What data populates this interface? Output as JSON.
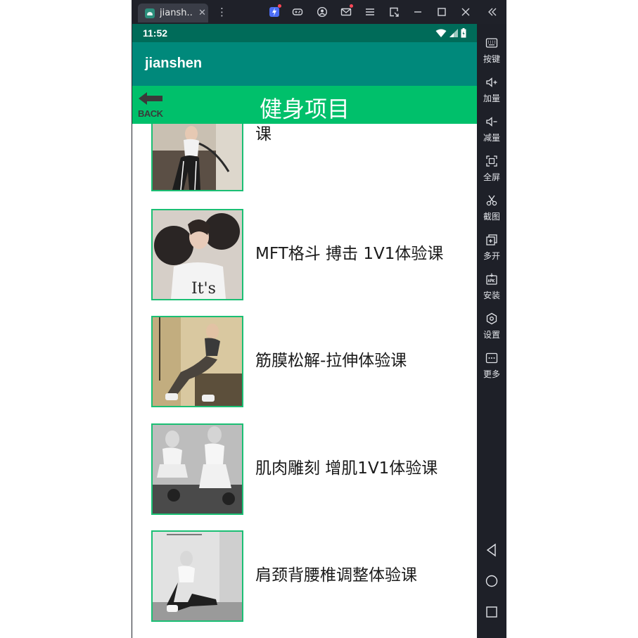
{
  "tabbar": {
    "tab_title": "jiansh...",
    "tab_close": "✕",
    "kebab": "⋮",
    "icons": [
      "bolt-icon",
      "gamepad-icon",
      "account-icon",
      "mail-icon",
      "menu-icon",
      "screen-rotate-icon",
      "minimize-icon",
      "maximize-icon",
      "close-icon",
      "collapse-icon"
    ]
  },
  "statusbar": {
    "time": "11:52"
  },
  "appbar": {
    "title": "jianshen"
  },
  "titlebar": {
    "back_label": "BACK",
    "title": "健身项目"
  },
  "list": {
    "items": [
      {
        "title": "蜜桃臀 马甲线 全身塑形体验课"
      },
      {
        "title": "MFT格斗 搏击 1V1体验课",
        "image_caption": "It's"
      },
      {
        "title": "筋膜松解-拉伸体验课"
      },
      {
        "title": "肌肉雕刻 增肌1V1体验课"
      },
      {
        "title": "肩颈背腰椎调整体验课"
      }
    ]
  },
  "sidebar": {
    "items": [
      {
        "label": "按键",
        "icon": "keyboard-icon"
      },
      {
        "label": "加量",
        "icon": "volume-up-icon"
      },
      {
        "label": "减量",
        "icon": "volume-down-icon"
      },
      {
        "label": "全屏",
        "icon": "fullscreen-icon"
      },
      {
        "label": "截图",
        "icon": "scissors-icon"
      },
      {
        "label": "多开",
        "icon": "multi-instance-icon"
      },
      {
        "label": "安装",
        "icon": "apk-install-icon"
      },
      {
        "label": "设置",
        "icon": "settings-icon"
      },
      {
        "label": "更多",
        "icon": "more-icon"
      }
    ],
    "nav": [
      "back-nav-icon",
      "home-nav-icon",
      "recents-nav-icon"
    ]
  },
  "colors": {
    "status_bar": "#006b59",
    "app_bar": "#00897b",
    "title_bar": "#00c06b",
    "thumb_border": "#1bbf74",
    "sidebar": "#1e2028"
  }
}
